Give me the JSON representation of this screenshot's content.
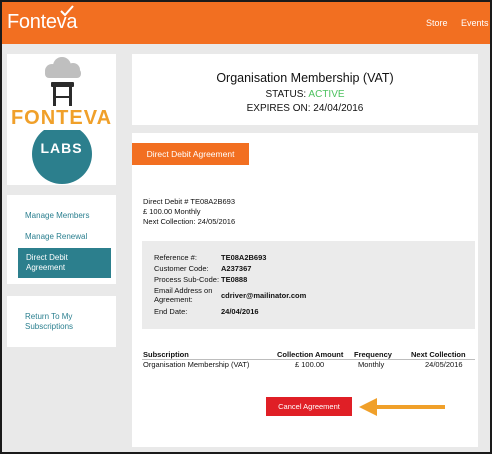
{
  "app": {
    "brand": "Fonteva",
    "nav": [
      "Store",
      "Events"
    ],
    "accent_color": "#f26f21"
  },
  "sidebar": {
    "logo": {
      "icon": "fonteva-labs-logo",
      "text_top": "FONTEVA",
      "text_bottom": "LABS"
    },
    "menu": [
      {
        "label": "Manage Members"
      },
      {
        "label": "Manage Renewal"
      },
      {
        "label": "Direct Debit\nAgreement",
        "active": true
      }
    ],
    "return_link": "Return To My\nSubscriptions"
  },
  "header": {
    "title": "Organisation Membership (VAT)",
    "status_label": "STATUS: ",
    "status_value": "ACTIVE",
    "expires": "EXPIRES ON: 24/04/2016"
  },
  "direct_debit": {
    "button_label": "Direct Debit Agreement",
    "summary": [
      "Direct Debit # TE08A2B693",
      "£ 100.00  Monthly",
      "Next Collection:  24/05/2016"
    ],
    "details": [
      {
        "label": "Reference #:",
        "value": "TE08A2B693"
      },
      {
        "label": "Customer Code:",
        "value": "A237367"
      },
      {
        "label": "Process Sub-Code:",
        "value": "TE0888"
      },
      {
        "label": "Email Address on\nAgreement:",
        "value": "cdriver@mailinator.com"
      },
      {
        "label": "End Date:",
        "value": "24/04/2016"
      }
    ],
    "table": {
      "headers": [
        "Subscription",
        "Collection Amount",
        "Frequency",
        "Next Collection"
      ],
      "rows": [
        [
          "Organisation Membership (VAT)",
          "£ 100.00",
          "Monthly",
          "24/05/2016"
        ]
      ]
    },
    "cancel_label": "Cancel Agreement"
  },
  "colors": {
    "teal": "#2c7f8d",
    "status_green": "#4cc15e",
    "cancel_red": "#e01f26",
    "annotation_arrow": "#f0a02a"
  }
}
